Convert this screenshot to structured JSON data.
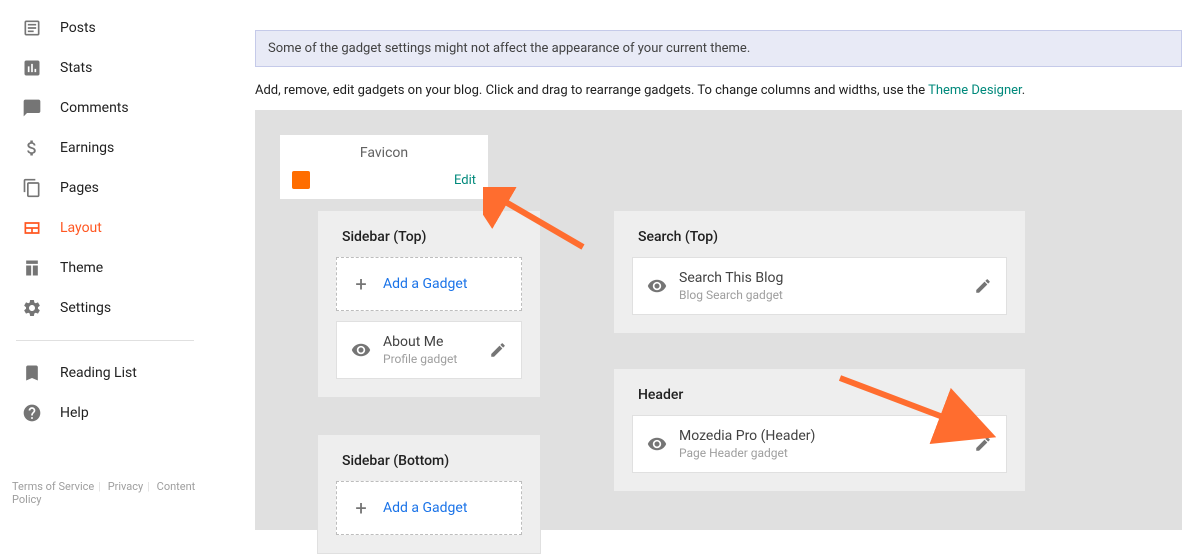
{
  "nav": {
    "posts": "Posts",
    "stats": "Stats",
    "comments": "Comments",
    "earnings": "Earnings",
    "pages": "Pages",
    "layout": "Layout",
    "theme": "Theme",
    "settings": "Settings",
    "reading_list": "Reading List",
    "help": "Help"
  },
  "footer": {
    "tos": "Terms of Service",
    "privacy": "Privacy",
    "content": "Content Policy"
  },
  "info_bar": "Some of the gadget settings might not affect the appearance of your current theme.",
  "description": {
    "pre": "Add, remove, edit gadgets on your blog. Click and drag to rearrange gadgets. To change columns and widths, use the ",
    "link": "Theme Designer",
    "post": "."
  },
  "favicon": {
    "title": "Favicon",
    "edit": "Edit"
  },
  "add_gadget": "Add a Gadget",
  "sections": {
    "sidebar_top": {
      "title": "Sidebar (Top)",
      "about": {
        "name": "About Me",
        "sub": "Profile gadget"
      }
    },
    "sidebar_bottom": {
      "title": "Sidebar (Bottom)"
    },
    "search_top": {
      "title": "Search (Top)",
      "search": {
        "name": "Search This Blog",
        "sub": "Blog Search gadget"
      }
    },
    "header": {
      "title": "Header",
      "gadget": {
        "name": "Mozedia Pro (Header)",
        "sub": "Page Header gadget"
      }
    }
  }
}
